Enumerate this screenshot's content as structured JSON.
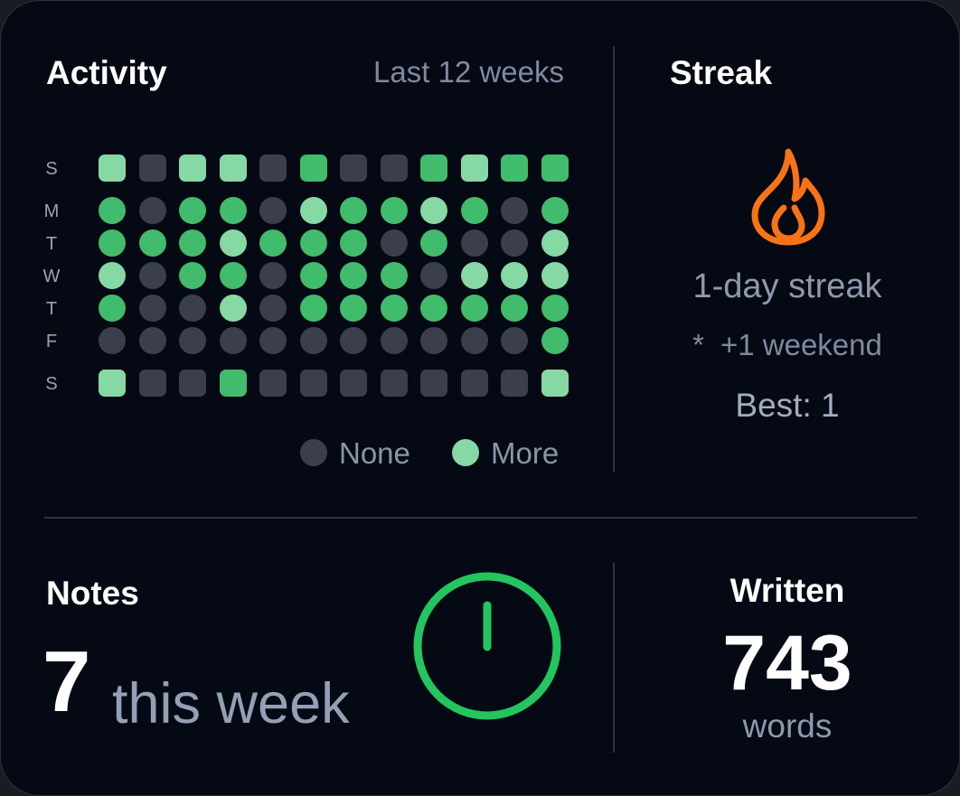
{
  "activity": {
    "title": "Activity",
    "range": "Last 12 weeks",
    "day_labels": [
      "S",
      "M",
      "T",
      "W",
      "T",
      "F",
      "S"
    ],
    "level_colors": [
      "#3a3f4b",
      "#41bb6c",
      "#86d8a4"
    ],
    "grid_levels": [
      [
        2,
        0,
        2,
        2,
        0,
        1,
        0,
        0,
        1,
        2,
        1,
        1
      ],
      [
        1,
        0,
        1,
        1,
        0,
        2,
        1,
        1,
        2,
        1,
        0,
        1
      ],
      [
        1,
        1,
        1,
        2,
        1,
        1,
        1,
        0,
        1,
        0,
        0,
        2
      ],
      [
        2,
        0,
        1,
        1,
        0,
        1,
        1,
        1,
        0,
        2,
        2,
        2
      ],
      [
        1,
        0,
        0,
        2,
        0,
        1,
        1,
        1,
        1,
        1,
        1,
        1
      ],
      [
        0,
        0,
        0,
        0,
        0,
        0,
        0,
        0,
        0,
        0,
        0,
        1
      ],
      [
        2,
        0,
        0,
        1,
        0,
        0,
        0,
        0,
        0,
        0,
        0,
        2
      ]
    ],
    "legend_none": "None",
    "legend_more": "More"
  },
  "streak": {
    "title": "Streak",
    "icon": "flame-icon",
    "icon_color": "#f97316",
    "current": "1-day streak",
    "weekend_symbol": "*",
    "weekend": "+1 weekend",
    "best": "Best: 1"
  },
  "notes": {
    "title": "Notes",
    "count": "7",
    "suffix": "this week",
    "ring_color": "#22c55e",
    "ring_icon": "clock-ring-icon"
  },
  "written": {
    "title": "Written",
    "value": "743",
    "unit": "words"
  }
}
